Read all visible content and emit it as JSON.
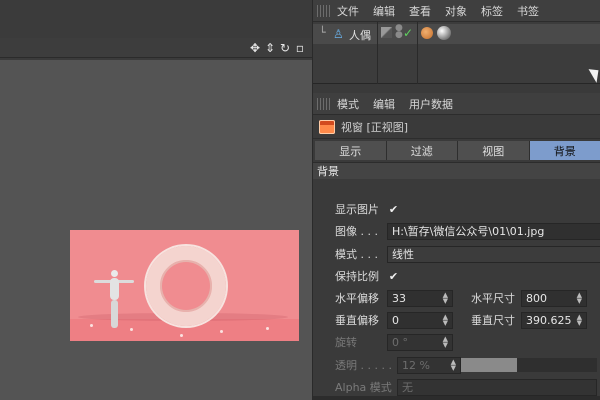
{
  "object_manager": {
    "menu": [
      "文件",
      "编辑",
      "查看",
      "对象",
      "标签",
      "书签"
    ],
    "object_name": "人偶"
  },
  "viewport": {
    "icons": [
      "move-icon",
      "pan-icon",
      "rotate-icon",
      "maximize-icon"
    ]
  },
  "attribute_manager": {
    "menu": [
      "模式",
      "编辑",
      "用户数据"
    ],
    "title": "视窗 [正视图]",
    "tabs": [
      "显示",
      "过滤",
      "视图",
      "背景"
    ],
    "active_tab": "背景",
    "section": "背景",
    "fields": {
      "show_image_label": "显示图片",
      "show_image_checked": "✔",
      "image_label": "图像 . . .",
      "image_value": "H:\\暂存\\微信公众号\\01\\01.jpg",
      "mode_label": "模式 . . .",
      "mode_value": "线性",
      "keep_ratio_label": "保持比例",
      "keep_ratio_checked": "✔",
      "h_offset_label": "水平偏移",
      "h_offset_value": "33",
      "h_size_label": "水平尺寸",
      "h_size_value": "800",
      "v_offset_label": "垂直偏移",
      "v_offset_value": "0",
      "v_size_label": "垂直尺寸",
      "v_size_value": "390.625",
      "rotation_label": "旋转",
      "rotation_value": "0 °",
      "transparency_label": "透明 . . . . .",
      "transparency_value": "12 %",
      "alpha_mode_label": "Alpha 模式",
      "alpha_mode_value": "无"
    }
  },
  "colors": {
    "active_tab": "#7d9ccc",
    "render_background": "#f08c90"
  }
}
